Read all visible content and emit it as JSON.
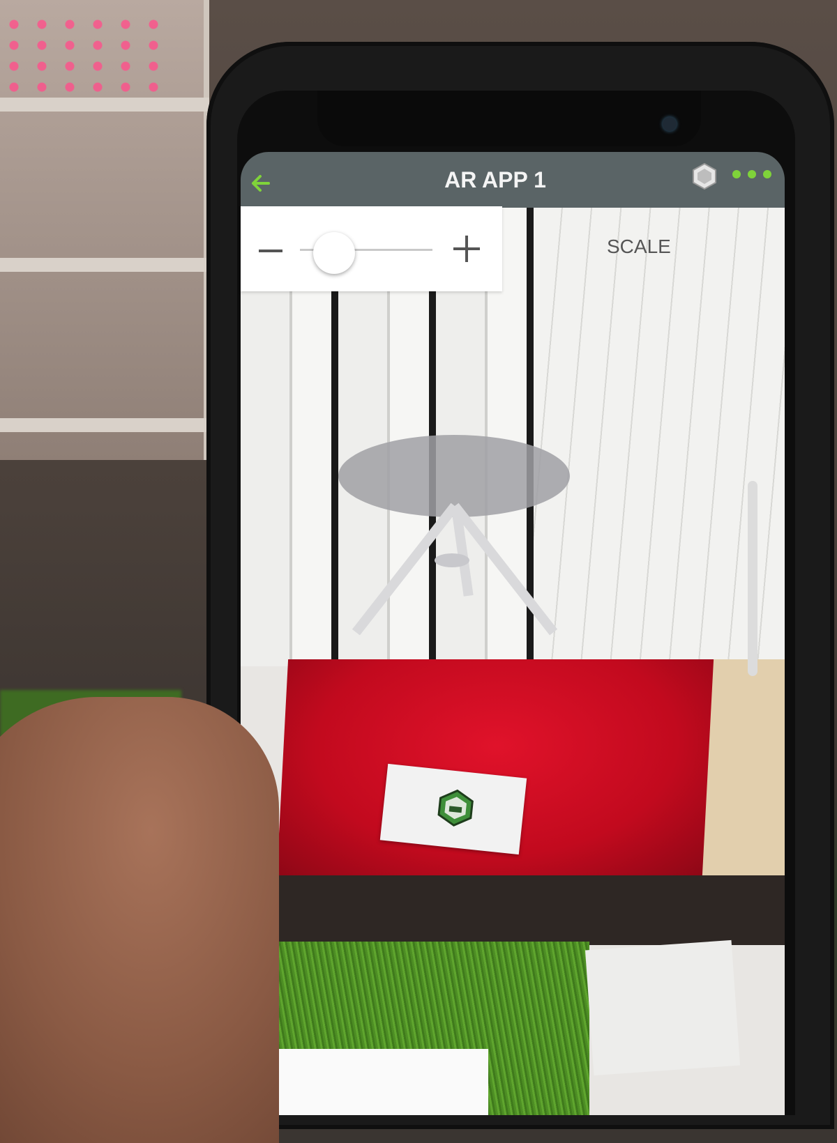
{
  "app": {
    "title": "AR APP 1"
  },
  "scale_control": {
    "minus_label": "−",
    "plus_label": "+",
    "label": "SCALE",
    "value_fraction": 0.15
  },
  "colors": {
    "accent": "#7fd33a",
    "appbar": "#5a6466"
  },
  "icons": {
    "back": "arrow-left-icon",
    "ar_marker": "hexagon-logo-icon",
    "menu": "more-dots-icon"
  }
}
